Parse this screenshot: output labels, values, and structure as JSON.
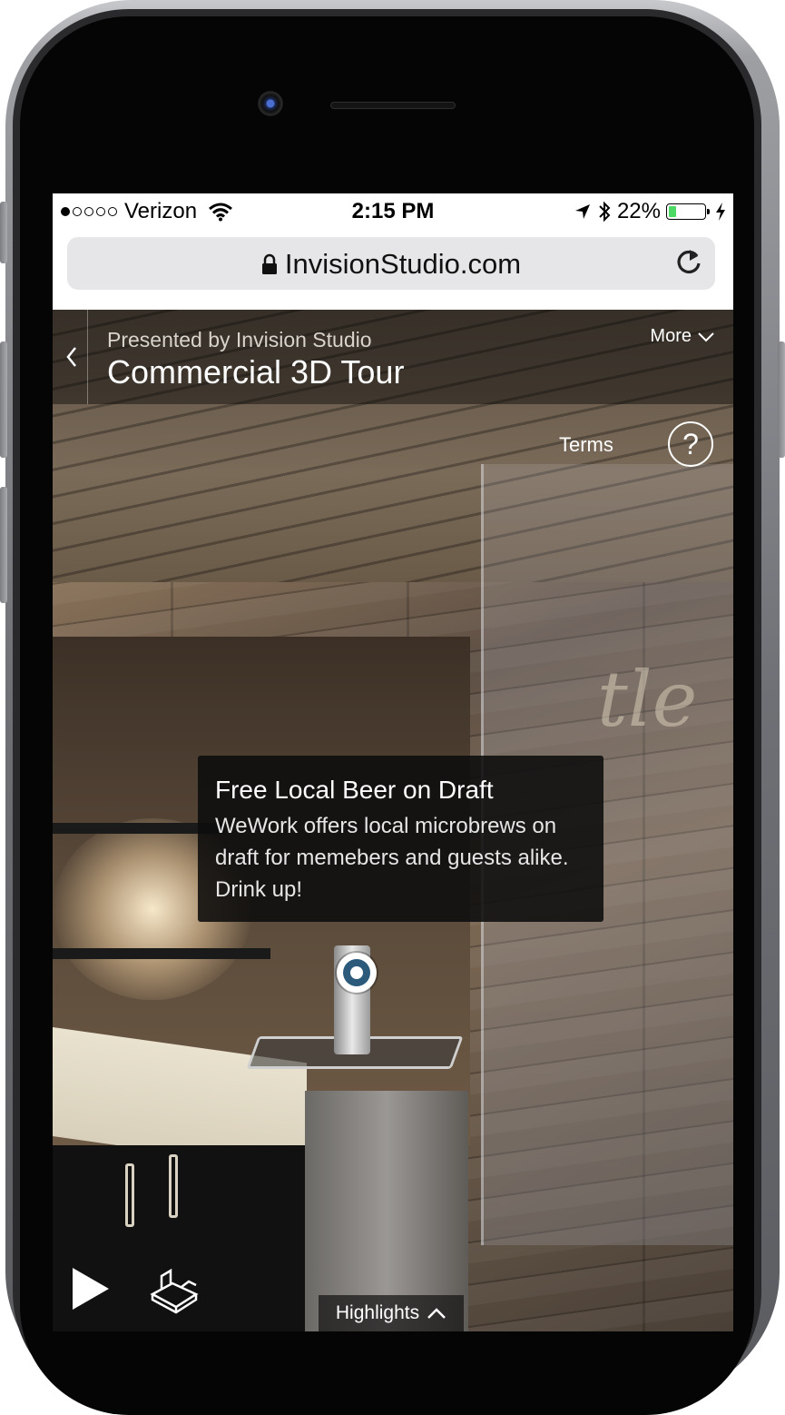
{
  "status_bar": {
    "carrier": "Verizon",
    "time": "2:15 PM",
    "battery_percent": "22%",
    "battery_level": 0.22
  },
  "browser": {
    "url": "InvisionStudio.com"
  },
  "tour": {
    "presented_by": "Presented by Invision Studio",
    "title": "Commercial 3D Tour",
    "more_label": "More",
    "terms_label": "Terms",
    "help_label": "?",
    "highlights_label": "Highlights"
  },
  "tooltip": {
    "title": "Free Local Beer on Draft",
    "body": "WeWork offers local microbrews on draft for memebers and guests alike. Drink up!"
  },
  "colors": {
    "battery_fill": "#4cd964",
    "hotspot_ring": "#2c5a7a",
    "header_overlay": "rgba(0,0,0,0.42)"
  },
  "icons": [
    "wifi-icon",
    "location-arrow-icon",
    "bluetooth-icon",
    "charging-bolt-icon",
    "lock-icon",
    "reload-icon",
    "back-chevron-icon",
    "chevron-down-icon",
    "help-icon",
    "play-icon",
    "floorplan-icon",
    "chevron-up-icon",
    "hotspot-icon"
  ]
}
